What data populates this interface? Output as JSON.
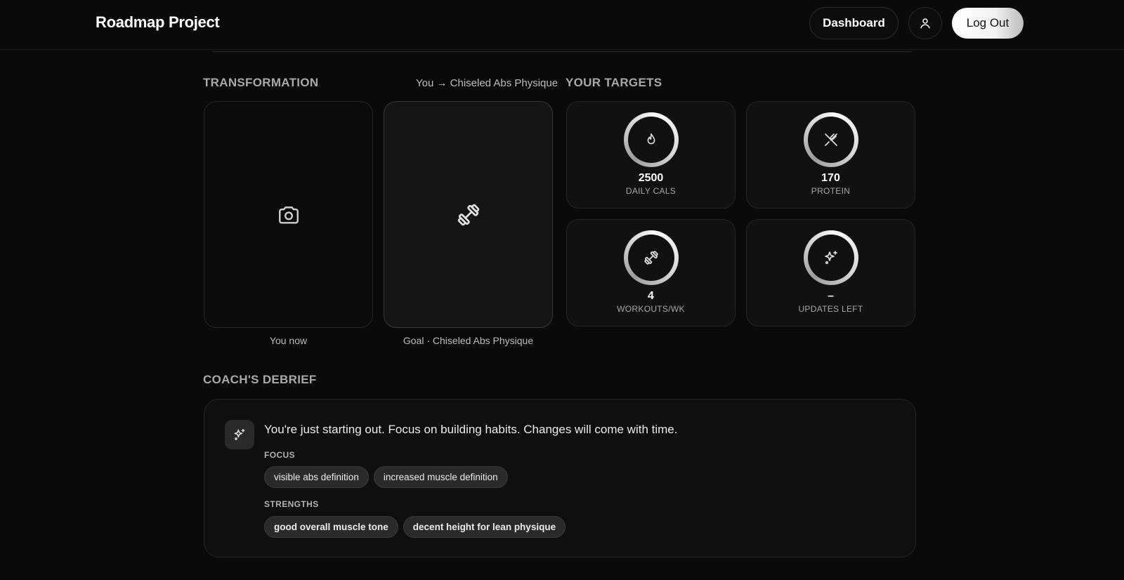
{
  "header": {
    "brand": "Roadmap Project",
    "dashboard_label": "Dashboard",
    "profile_icon": "user-icon",
    "logout_label": "Log Out"
  },
  "transformation": {
    "title": "TRANSFORMATION",
    "subtitle": "You → Chiseled Abs Physique",
    "now_label": "You now",
    "goal_label": "Goal · Chiseled Abs Physique",
    "now_icon": "camera-icon",
    "goal_icon": "dumbbell-icon"
  },
  "targets": {
    "title": "YOUR TARGETS",
    "items": [
      {
        "icon": "flame-icon",
        "value": "2500",
        "label": "DAILY CALS"
      },
      {
        "icon": "utensils-icon",
        "value": "170",
        "label": "PROTEIN"
      },
      {
        "icon": "dumbbell-icon",
        "value": "4",
        "label": "WORKOUTS/WK"
      },
      {
        "icon": "sparkles-icon",
        "value": "–",
        "label": "UPDATES LEFT"
      }
    ]
  },
  "debrief": {
    "title": "COACH'S DEBRIEF",
    "icon": "sparkles-icon",
    "message": "You're just starting out. Focus on building habits. Changes will come with time.",
    "focus_heading": "FOCUS",
    "focus": [
      "visible abs definition",
      "increased muscle definition"
    ],
    "strengths_heading": "STRENGTHS",
    "strengths": [
      "good overall muscle tone",
      "decent height for lean physique"
    ]
  }
}
